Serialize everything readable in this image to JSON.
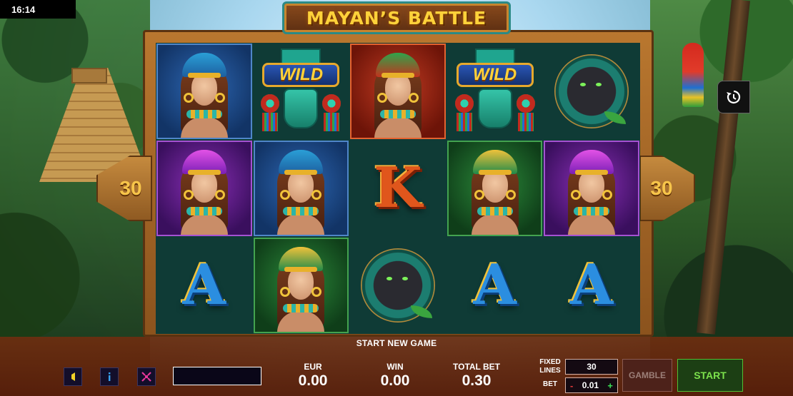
{
  "status_bar": {
    "time": "16:14"
  },
  "game": {
    "title": "MAYAN’S BATTLE"
  },
  "lines": {
    "left_count": "30",
    "right_count": "30"
  },
  "reels": [
    [
      {
        "symbol": "woman-blue",
        "bg": "blue",
        "label": ""
      },
      {
        "symbol": "wild",
        "bg": "none",
        "label": "WILD"
      },
      {
        "symbol": "woman-red",
        "bg": "red",
        "label": ""
      },
      {
        "symbol": "wild",
        "bg": "none",
        "label": "WILD"
      },
      {
        "symbol": "panther",
        "bg": "none",
        "label": ""
      }
    ],
    [
      {
        "symbol": "woman-purple",
        "bg": "purple",
        "label": ""
      },
      {
        "symbol": "woman-blue",
        "bg": "blue",
        "label": ""
      },
      {
        "symbol": "letter-k",
        "bg": "none",
        "label": "K"
      },
      {
        "symbol": "woman-green",
        "bg": "green",
        "label": ""
      },
      {
        "symbol": "woman-purple",
        "bg": "purple",
        "label": ""
      }
    ],
    [
      {
        "symbol": "letter-a",
        "bg": "none",
        "label": "A"
      },
      {
        "symbol": "woman-green",
        "bg": "green",
        "label": ""
      },
      {
        "symbol": "panther",
        "bg": "none",
        "label": ""
      },
      {
        "symbol": "letter-a",
        "bg": "none",
        "label": "A"
      },
      {
        "symbol": "letter-a",
        "bg": "none",
        "label": "A"
      }
    ]
  ],
  "bottom": {
    "message": "START NEW GAME",
    "eur_label": "EUR",
    "eur_value": "0.00",
    "win_label": "WIN",
    "win_value": "0.00",
    "total_bet_label": "TOTAL BET",
    "total_bet_value": "0.30",
    "fixed_lines_label_1": "FIXED",
    "fixed_lines_label_2": "LINES",
    "fixed_lines_value": "30",
    "bet_label": "BET",
    "bet_minus": "-",
    "bet_value": "0.01",
    "bet_plus": "+",
    "gamble_label": "GAMBLE",
    "start_label": "START"
  },
  "icons": {
    "sound": "speaker-icon",
    "info": "info-icon",
    "lines": "paylines-icon",
    "history": "history-icon"
  },
  "colors": {
    "start_green": "#7ce14c",
    "gamble_disabled": "#9c7f78",
    "title_gold": "#ffd23a"
  }
}
